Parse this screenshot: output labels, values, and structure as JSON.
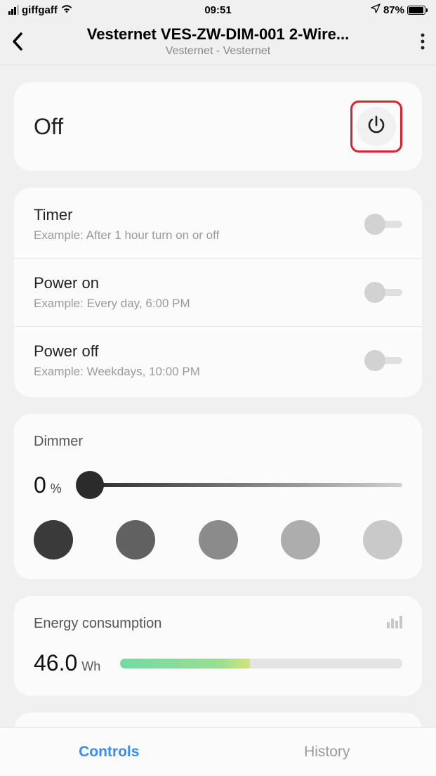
{
  "status": {
    "carrier": "giffgaff",
    "time": "09:51",
    "battery_pct": "87%"
  },
  "header": {
    "title": "Vesternet VES-ZW-DIM-001 2-Wire...",
    "subtitle": "Vesternet - Vesternet"
  },
  "power": {
    "state": "Off"
  },
  "schedules": [
    {
      "title": "Timer",
      "subtitle": "Example: After 1 hour turn on or off",
      "on": false
    },
    {
      "title": "Power on",
      "subtitle": "Example: Every day, 6:00 PM",
      "on": false
    },
    {
      "title": "Power off",
      "subtitle": "Example: Weekdays, 10:00 PM",
      "on": false
    }
  ],
  "dimmer": {
    "label": "Dimmer",
    "value": "0",
    "unit": "%",
    "slider_position": 0,
    "presets": [
      "#3a3a3a",
      "#616161",
      "#8b8b8b",
      "#adadad",
      "#c9c9c9"
    ]
  },
  "energy": {
    "label": "Energy consumption",
    "value": "46.0",
    "unit": "Wh",
    "bar_green_pct": 36,
    "bar_yellow_pct": 10
  },
  "nav": {
    "controls": "Controls",
    "history": "History",
    "active": "controls"
  }
}
